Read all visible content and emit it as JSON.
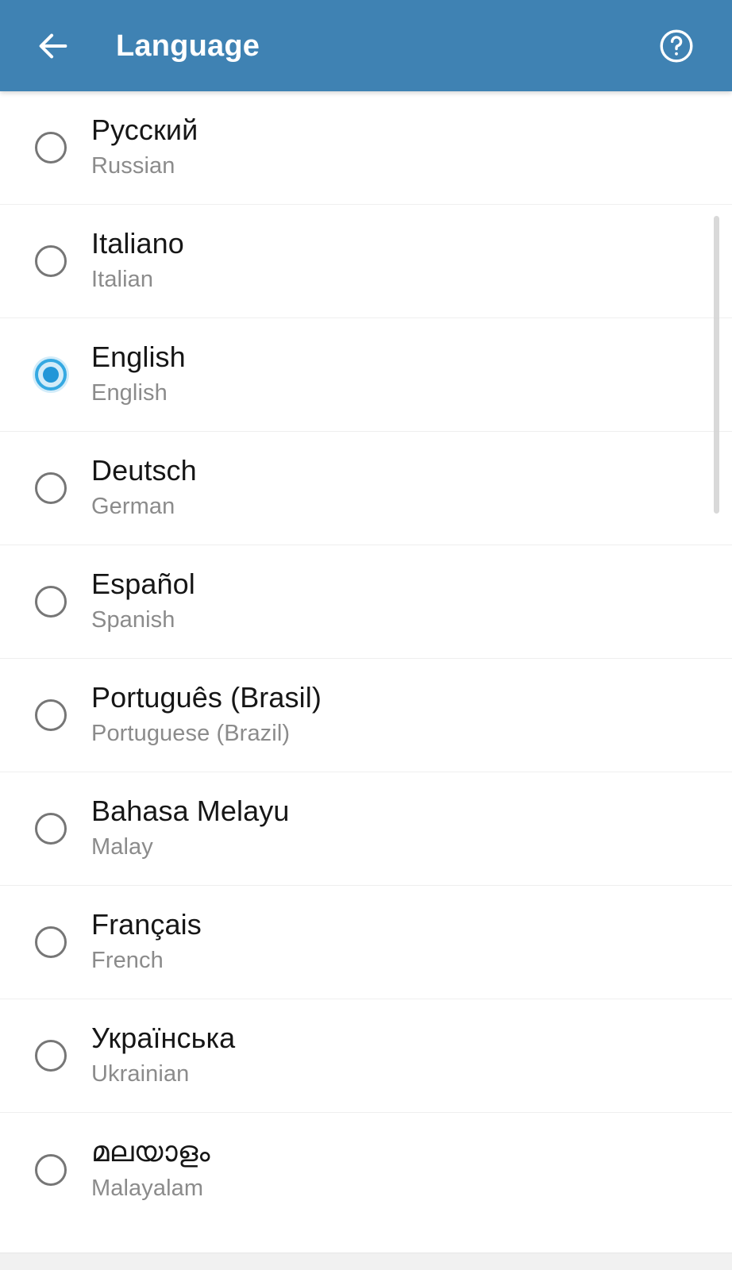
{
  "appbar": {
    "title": "Language",
    "back_icon": "arrow-left-icon",
    "help_icon": "help-circle-icon",
    "background_color": "#3f82b3",
    "text_color": "#ffffff"
  },
  "theme": {
    "accent_color": "#2196d8",
    "selected_ring_color": "#35a9e2",
    "unselected_ring_color": "#767676",
    "primary_text_color": "#161616",
    "secondary_text_color": "#8b8b8b",
    "divider_color": "#efefef",
    "background_color": "#ffffff"
  },
  "list": {
    "selected_index": 2,
    "items": [
      {
        "native": "Русский",
        "english": "Russian",
        "selected": false
      },
      {
        "native": "Italiano",
        "english": "Italian",
        "selected": false
      },
      {
        "native": "English",
        "english": "English",
        "selected": true
      },
      {
        "native": "Deutsch",
        "english": "German",
        "selected": false
      },
      {
        "native": "Español",
        "english": "Spanish",
        "selected": false
      },
      {
        "native": "Português (Brasil)",
        "english": "Portuguese (Brazil)",
        "selected": false
      },
      {
        "native": "Bahasa Melayu",
        "english": "Malay",
        "selected": false
      },
      {
        "native": "Français",
        "english": "French",
        "selected": false
      },
      {
        "native": "Українська",
        "english": "Ukrainian",
        "selected": false
      },
      {
        "native": "മലയാളം",
        "english": "Malayalam",
        "selected": false
      }
    ]
  },
  "scrollbar": {
    "visible": true
  }
}
